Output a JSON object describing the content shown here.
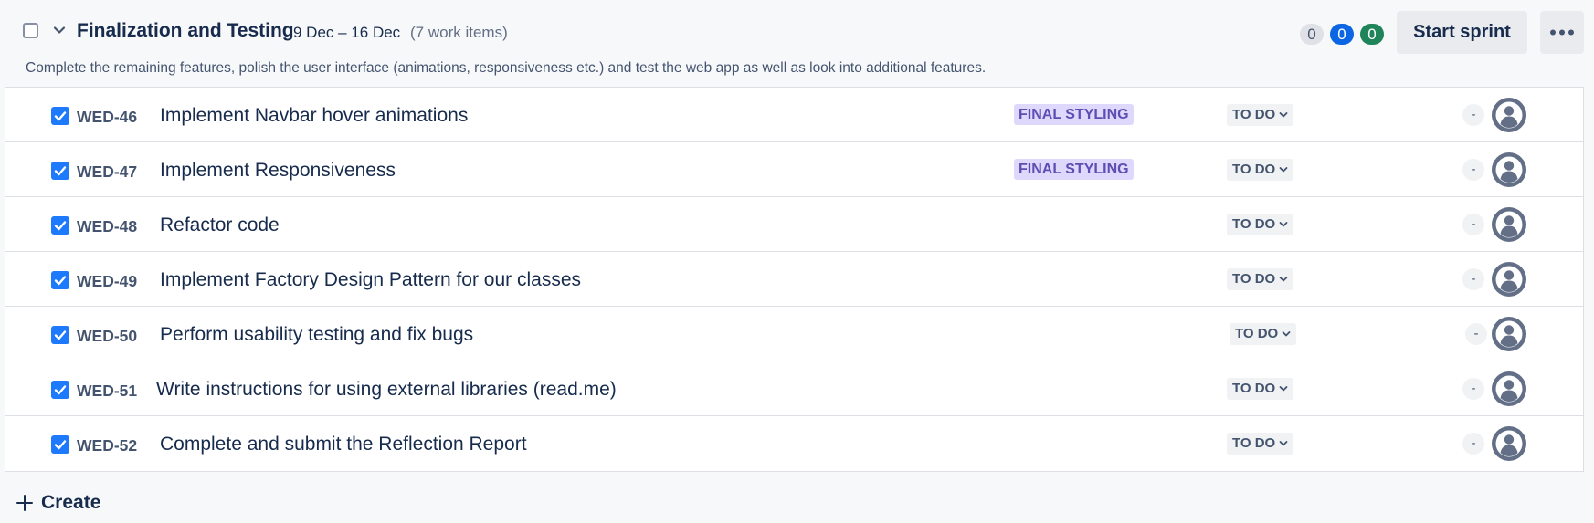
{
  "sprint": {
    "title": "Finalization and Testing",
    "dates": "9 Dec – 16 Dec",
    "work_item_count": "(7 work items)",
    "goal": "Complete the remaining features, polish the user interface (animations, responsiveness etc.) and test the web app as well as look into additional features.",
    "counts": {
      "todo": "0",
      "in_progress": "0",
      "done": "0"
    },
    "start_button": "Start sprint",
    "more_actions_icon": "more-horizontal-icon"
  },
  "colors": {
    "todo_pill": "#dfe1e6",
    "in_progress_pill": "#0c66e4",
    "done_pill": "#1f845a",
    "checkbox_checked": "#1d7afc",
    "epic_bg": "#dfd8fd",
    "epic_text": "#5e4db2"
  },
  "issues": [
    {
      "key": "WED-46",
      "summary": "Implement Navbar hover animations",
      "epic": "FINAL STYLING",
      "status": "TO DO",
      "estimate": "-"
    },
    {
      "key": "WED-47",
      "summary": "Implement Responsiveness",
      "epic": "FINAL STYLING",
      "status": "TO DO",
      "estimate": "-"
    },
    {
      "key": "WED-48",
      "summary": "Refactor code",
      "epic": "",
      "status": "TO DO",
      "estimate": "-"
    },
    {
      "key": "WED-49",
      "summary": "Implement Factory Design Pattern for our classes",
      "epic": "",
      "status": "TO DO",
      "estimate": "-"
    },
    {
      "key": "WED-50",
      "summary": "Perform usability testing and fix bugs",
      "epic": "",
      "status": "TO DO",
      "estimate": "-"
    },
    {
      "key": "WED-51",
      "summary": "Write instructions for using external libraries (read.me)",
      "epic": "",
      "status": "TO DO",
      "estimate": "-"
    },
    {
      "key": "WED-52",
      "summary": "Complete and submit the Reflection Report",
      "epic": "",
      "status": "TO DO",
      "estimate": "-"
    }
  ],
  "create_label": "Create"
}
